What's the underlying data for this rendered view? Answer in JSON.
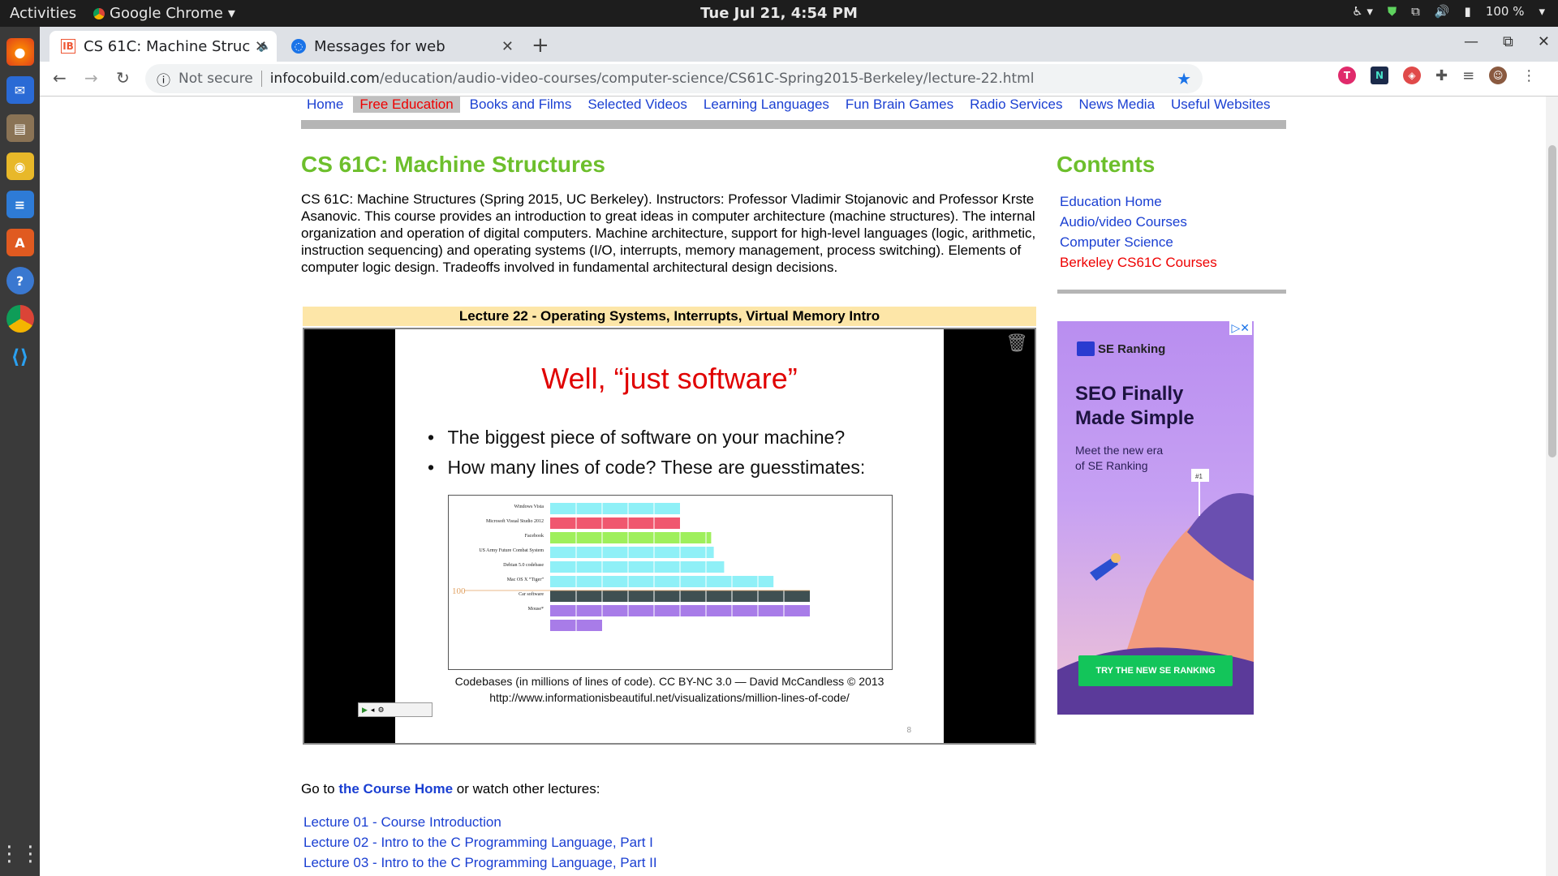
{
  "topbar": {
    "activities": "Activities",
    "app": "Google Chrome",
    "clock": "Tue Jul 21,  4:54 PM",
    "battery": "100 %"
  },
  "tabs": [
    {
      "title": "CS 61C: Machine Struc",
      "favicon": "IB",
      "active": true
    },
    {
      "title": "Messages for web",
      "favicon": "messages-icon",
      "active": false
    }
  ],
  "omnibox": {
    "security": "Not secure",
    "host": "infocobuild.com",
    "path": "/education/audio-video-courses/computer-science/CS61C-Spring2015-Berkeley/lecture-22.html"
  },
  "menu": [
    "Home",
    "Free Education",
    "Books and Films",
    "Selected Videos",
    "Learning Languages",
    "Fun Brain Games",
    "Radio Services",
    "News Media",
    "Useful Websites"
  ],
  "menu_selected": "Free Education",
  "page": {
    "title": "CS 61C: Machine Structures",
    "description": "CS 61C: Machine Structures (Spring 2015, UC Berkeley). Instructors: Professor Vladimir Stojanovic and Professor Krste Asanovic. This course provides an introduction to great ideas in computer architecture (machine structures). The internal organization and operation of digital computers. Machine architecture, support for high-level languages (logic, arithmetic, instruction sequencing) and operating systems (I/O, interrupts, memory management, process switching). Elements of computer logic design. Tradeoffs involved in fundamental architectural design decisions.",
    "lecture_title": "Lecture 22 - Operating Systems, Interrupts, Virtual Memory Intro",
    "goto_prefix": "Go to ",
    "goto_link": "the Course Home",
    "goto_suffix": " or watch other lectures:",
    "lectures": [
      "Lecture 01 - Course Introduction",
      "Lecture 02 - Intro to the C Programming Language, Part I",
      "Lecture 03 - Intro to the C Programming Language, Part II"
    ]
  },
  "slide": {
    "title": "Well, “just software”",
    "bullets": [
      "The biggest piece of software on your machine?",
      "How many lines of code? These are guesstimates:"
    ],
    "caption1": "Codebases (in millions of lines of code). CC BY-NC 3.0 — David McCandless © 2013",
    "caption2": "http://www.informationisbeautiful.net/visualizations/million-lines-of-code/",
    "page": "8",
    "axis_mark": "100"
  },
  "chart_data": {
    "type": "bar",
    "title": "",
    "categories": [
      "Windows Vista",
      "Microsoft Visual Studio 2012",
      "Facebook",
      "US Army Future Combat System",
      "Debian 5.0 codebase",
      "Mac OS X “Tiger”",
      "Car software",
      "Mouse*"
    ],
    "values": [
      50,
      50,
      62,
      63,
      67,
      86,
      100,
      120
    ],
    "colors": [
      "#8ff0f7",
      "#f0576f",
      "#9fef5c",
      "#8ff0f7",
      "#8ff0f7",
      "#8ff0f7",
      "#3f5052",
      "#a87ce8"
    ],
    "xlim": [
      0,
      100
    ]
  },
  "sidebar": {
    "title": "Contents",
    "links": [
      "Education Home",
      "Audio/video Courses",
      "Computer Science",
      "Berkeley CS61C Courses"
    ]
  },
  "ad": {
    "brand": "SE Ranking",
    "headline1": "SEO Finally",
    "headline2": "Made Simple",
    "sub1": "Meet the new era",
    "sub2": "of SE Ranking",
    "cta": "TRY THE NEW SE RANKING",
    "badge": "#1"
  }
}
